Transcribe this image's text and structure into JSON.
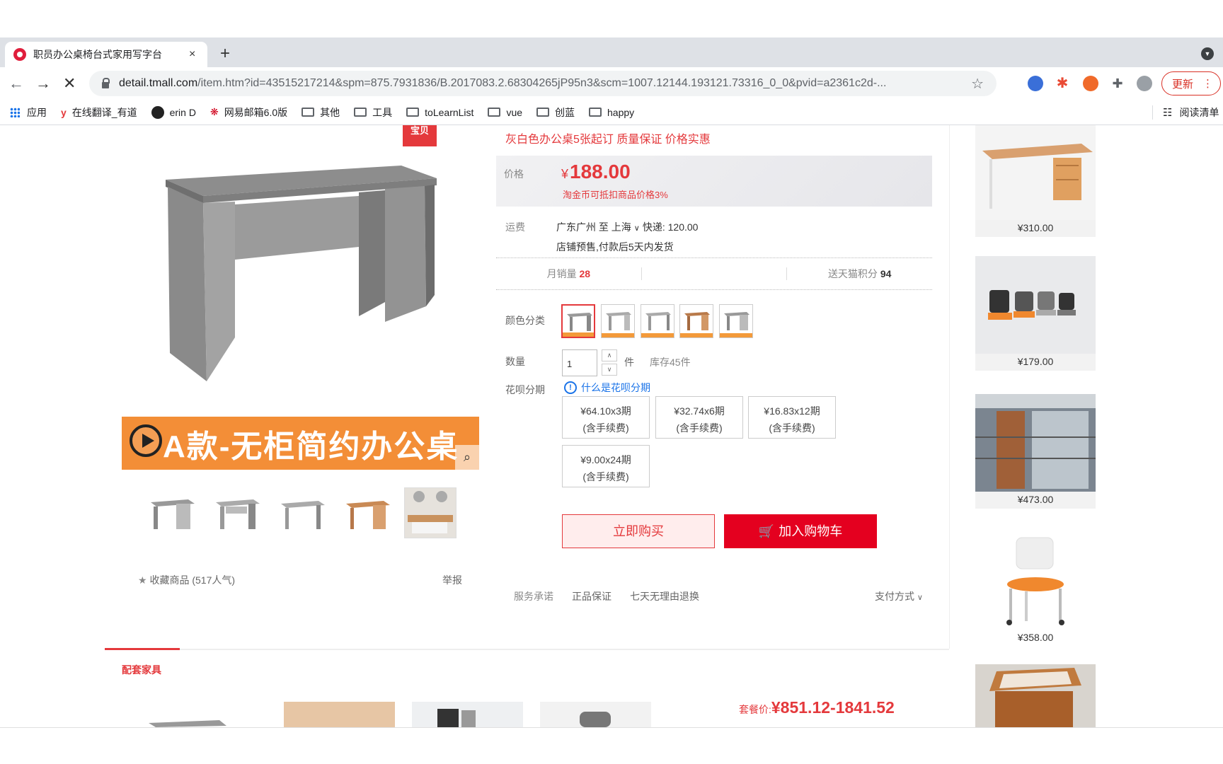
{
  "browser": {
    "tab_title": "职员办公桌椅台式家用写字台",
    "close_symbol": "×",
    "new_tab_symbol": "+",
    "url_host": "detail.tmall.com",
    "url_path": "/item.htm?id=43515217214&spm=875.7931836/B.2017083.2.68304265jP95n3&scm=1007.12144.193121.73316_0_0&pvid=a2361c2d-...",
    "update_label": "更新",
    "bookmarks": [
      {
        "label": "应用",
        "icon": "apps-grid-icon"
      },
      {
        "label": "在线翻译_有道",
        "icon": "youdao-icon"
      },
      {
        "label": "erin D",
        "icon": "github-icon"
      },
      {
        "label": "网易邮箱6.0版",
        "icon": "netease-mail-icon"
      },
      {
        "label": "其他",
        "icon": "folder-icon"
      },
      {
        "label": "工具",
        "icon": "folder-icon"
      },
      {
        "label": "toLearnList",
        "icon": "folder-icon"
      },
      {
        "label": "vue",
        "icon": "folder-icon"
      },
      {
        "label": "创蓝",
        "icon": "folder-icon"
      },
      {
        "label": "happy",
        "icon": "folder-icon"
      }
    ],
    "reading_list": "阅读清单"
  },
  "product": {
    "badge": "宝贝",
    "banner_text": "A款-无柜简约办公桌",
    "promo": "灰白色办公桌5张起订 质量保证 价格实惠",
    "price_label": "价格",
    "currency": "¥",
    "price": "188.00",
    "price_note": "淘金币可抵扣商品价格3%",
    "ship_label": "运费",
    "ship_route": "广东广州 至 上海",
    "ship_cost": "快递: 120.00",
    "ship_note": "店铺预售,付款后5天内发货",
    "monthly_sales_label": "月销量",
    "monthly_sales": "28",
    "points_label": "送天猫积分",
    "points": "94",
    "color_label": "颜色分类",
    "qty_label": "数量",
    "qty_value": "1",
    "unit": "件",
    "stock": "库存45件",
    "huabei_label": "花呗分期",
    "huabei_what": "什么是花呗分期",
    "installments": [
      {
        "amount": "¥64.10x3期",
        "fee": "(含手续费)"
      },
      {
        "amount": "¥32.74x6期",
        "fee": "(含手续费)"
      },
      {
        "amount": "¥16.83x12期",
        "fee": "(含手续费)"
      },
      {
        "amount": "¥9.00x24期",
        "fee": "(含手续费)"
      }
    ],
    "buy_now": "立即购买",
    "add_cart": "加入购物车",
    "service_label": "服务承诺",
    "services": [
      "正品保证",
      "七天无理由退换"
    ],
    "pay_label": "支付方式",
    "favorite": "收藏商品 (517人气)",
    "report": "举报"
  },
  "related": [
    {
      "price": "¥310.00"
    },
    {
      "price": "¥179.00"
    },
    {
      "price": "¥473.00"
    },
    {
      "price": "¥358.00"
    }
  ],
  "bundle": {
    "title": "配套家具",
    "price_label": "套餐价:",
    "price": "¥851.12-1841.52"
  },
  "colors": {
    "accent": "#e4393c",
    "cart": "#e4001f",
    "banner": "#f38e37"
  }
}
